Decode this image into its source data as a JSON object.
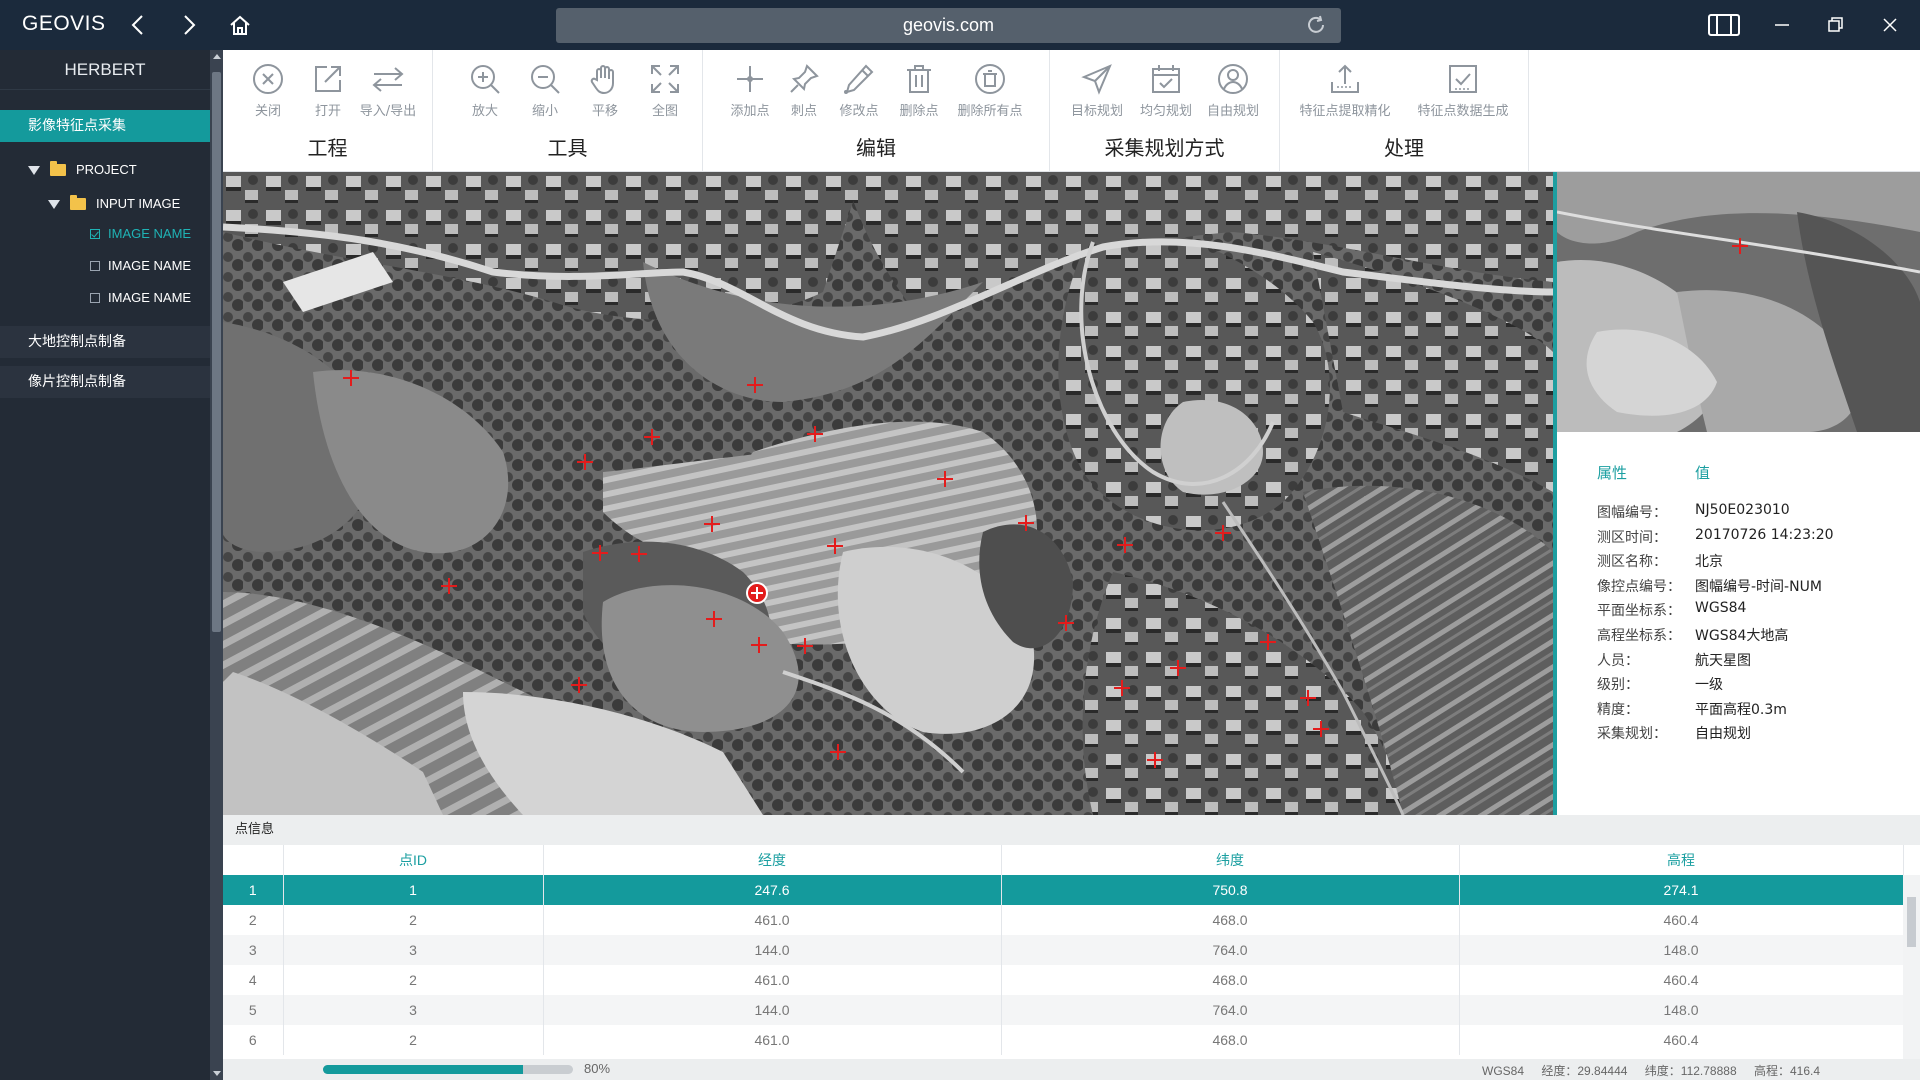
{
  "titlebar": {
    "brand": "GEOVIS",
    "url": "geovis.com"
  },
  "sidebar": {
    "user": "HERBERT",
    "active_section": "影像特征点采集",
    "tree": {
      "project": "PROJECT",
      "input_image": "INPUT IMAGE",
      "images": [
        {
          "label": "IMAGE NAME",
          "checked": true
        },
        {
          "label": "IMAGE NAME",
          "checked": false
        },
        {
          "label": "IMAGE NAME",
          "checked": false
        }
      ]
    },
    "sections": [
      "大地控制点制备",
      "像片控制点制备"
    ]
  },
  "ribbon": {
    "groups": [
      {
        "title": "工程",
        "tools": [
          "关闭",
          "打开",
          "导入/导出"
        ]
      },
      {
        "title": "工具",
        "tools": [
          "放大",
          "缩小",
          "平移",
          "全图"
        ]
      },
      {
        "title": "编辑",
        "tools": [
          "添加点",
          "刺点",
          "修改点",
          "删除点",
          "删除所有点"
        ]
      },
      {
        "title": "采集规划方式",
        "tools": [
          "目标规划",
          "均匀规划",
          "自由规划"
        ]
      },
      {
        "title": "处理",
        "tools": [
          "特征点提取精化",
          "特征点数据生成"
        ]
      }
    ]
  },
  "properties": {
    "header_key": "属性",
    "header_value": "值",
    "rows": [
      {
        "k": "图幅编号：",
        "v": "NJ50E023010"
      },
      {
        "k": "测区时间：",
        "v": "20170726  14:23:20"
      },
      {
        "k": "测区名称：",
        "v": "北京"
      },
      {
        "k": "像控点编号：",
        "v": "图幅编号-时间-NUM"
      },
      {
        "k": "平面坐标系：",
        "v": "WGS84"
      },
      {
        "k": "高程坐标系：",
        "v": "WGS84大地高"
      },
      {
        "k": "人员：",
        "v": "航天星图"
      },
      {
        "k": "级别：",
        "v": "一级"
      },
      {
        "k": "精度：",
        "v": "平面高程0.3m"
      },
      {
        "k": "采集规划：",
        "v": "自由规划"
      }
    ]
  },
  "table": {
    "title": "点信息",
    "columns": [
      "",
      "点ID",
      "经度",
      "纬度",
      "高程"
    ],
    "rows": [
      [
        "1",
        "1",
        "247.6",
        "750.8",
        "274.1"
      ],
      [
        "2",
        "2",
        "461.0",
        "468.0",
        "460.4"
      ],
      [
        "3",
        "3",
        "144.0",
        "764.0",
        "148.0"
      ],
      [
        "4",
        "2",
        "461.0",
        "468.0",
        "460.4"
      ],
      [
        "5",
        "3",
        "144.0",
        "764.0",
        "148.0"
      ],
      [
        "6",
        "2",
        "461.0",
        "468.0",
        "460.4"
      ]
    ],
    "selected_row": 0
  },
  "status": {
    "progress": 0.8,
    "progress_label": "80%",
    "crs": "WGS84",
    "lon": "经度：29.84444",
    "lat": "纬度：112.78888",
    "elev": "高程：416.4"
  },
  "colors": {
    "accent": "#149a9c",
    "titlebar": "#1b2a3c",
    "sidebar": "#232b36",
    "marker": "#e31c1c"
  }
}
